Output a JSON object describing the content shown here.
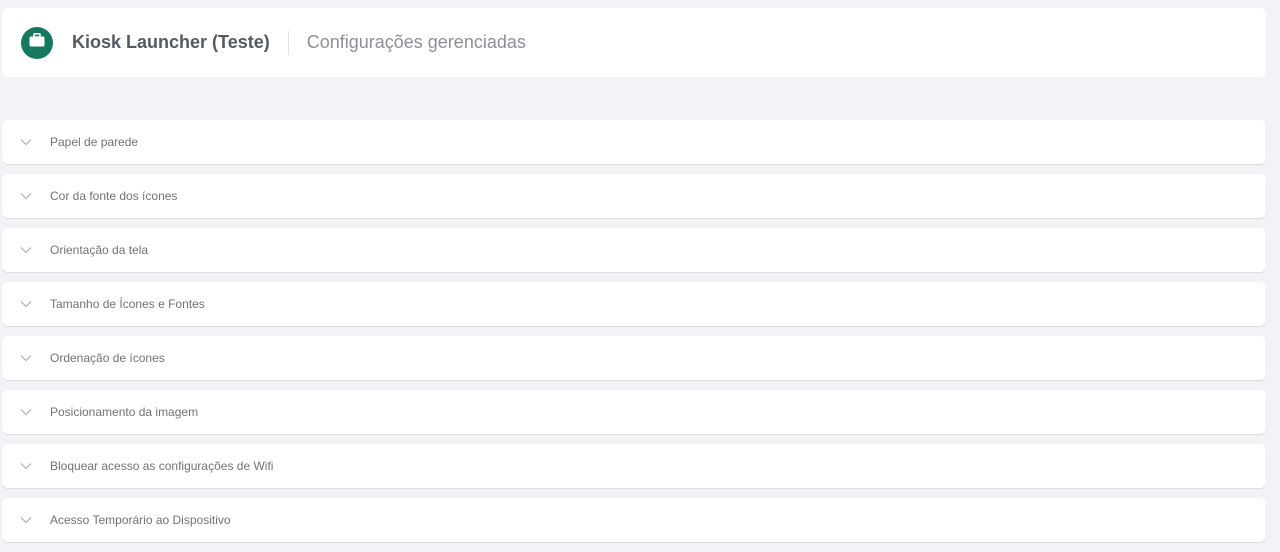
{
  "header": {
    "app_icon": "briefcase-icon",
    "title": "Kiosk Launcher (Teste)",
    "subtitle": "Configurações gerenciadas",
    "accent_color": "#16785f"
  },
  "sections": [
    {
      "label": "Papel de parede",
      "icon": "chevron-down-icon"
    },
    {
      "label": "Cor da fonte dos ícones",
      "icon": "chevron-down-icon"
    },
    {
      "label": "Orientação da tela",
      "icon": "chevron-down-icon"
    },
    {
      "label": "Tamanho de Ícones e Fontes",
      "icon": "chevron-down-icon"
    },
    {
      "label": "Ordenação de ícones",
      "icon": "chevron-down-icon"
    },
    {
      "label": "Posicionamento da imagem",
      "icon": "chevron-down-icon"
    },
    {
      "label": "Bloquear acesso as configurações de Wifi",
      "icon": "chevron-down-icon"
    },
    {
      "label": "Acesso Temporário ao Dispositivo",
      "icon": "chevron-down-icon"
    }
  ]
}
